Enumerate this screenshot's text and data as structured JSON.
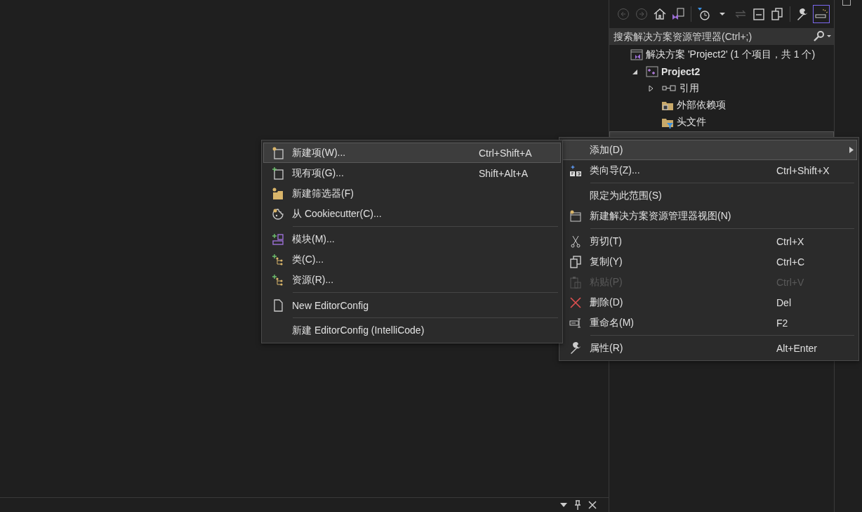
{
  "solution_explorer": {
    "toolbar": [
      {
        "kind": "back",
        "disabled": true
      },
      {
        "kind": "forward",
        "disabled": true
      },
      {
        "kind": "home",
        "disabled": false
      },
      {
        "kind": "views",
        "disabled": false
      },
      {
        "kind": "separator"
      },
      {
        "kind": "pending",
        "disabled": false
      },
      {
        "kind": "dropdown",
        "disabled": false
      },
      {
        "kind": "sync",
        "disabled": true
      },
      {
        "kind": "collapse",
        "disabled": false
      },
      {
        "kind": "copies",
        "disabled": false
      },
      {
        "kind": "separator"
      },
      {
        "kind": "properties",
        "disabled": false
      },
      {
        "kind": "preview",
        "disabled": false,
        "selected": true
      }
    ],
    "search": {
      "placeholder": "搜索解决方案资源管理器(Ctrl+;)"
    },
    "tree": [
      {
        "label": "解决方案 'Project2' (1 个项目，共 1 个)",
        "kind": "solution",
        "children": [
          {
            "label": "Project2",
            "kind": "project",
            "expanded": true,
            "children": [
              {
                "label": "引用",
                "kind": "references",
                "expanded": false
              },
              {
                "label": "外部依赖项",
                "kind": "external"
              },
              {
                "label": "头文件",
                "kind": "filter"
              }
            ]
          }
        ]
      }
    ]
  },
  "context_menu": [
    {
      "kind": "plain",
      "label": "添加(D)",
      "highlighted": true,
      "has_submenu": true,
      "disabled": false
    },
    {
      "kind": "wizard",
      "label": "类向导(Z)...",
      "shortcut": "Ctrl+Shift+X",
      "highlighted": false,
      "has_submenu": false,
      "disabled": false
    },
    {
      "kind": "separator"
    },
    {
      "kind": "plain",
      "label": "限定为此范围(S)",
      "highlighted": false,
      "has_submenu": false,
      "disabled": false
    },
    {
      "kind": "newview",
      "label": "新建解决方案资源管理器视图(N)",
      "highlighted": false,
      "has_submenu": false,
      "disabled": false
    },
    {
      "kind": "separator"
    },
    {
      "kind": "scissors",
      "label": "剪切(T)",
      "shortcut": "Ctrl+X",
      "highlighted": false,
      "has_submenu": false,
      "disabled": false
    },
    {
      "kind": "copy",
      "label": "复制(Y)",
      "shortcut": "Ctrl+C",
      "highlighted": false,
      "has_submenu": false,
      "disabled": false
    },
    {
      "kind": "paste",
      "label": "粘贴(P)",
      "shortcut": "Ctrl+V",
      "highlighted": false,
      "has_submenu": false,
      "disabled": true
    },
    {
      "kind": "delete",
      "label": "删除(D)",
      "shortcut": "Del",
      "highlighted": false,
      "has_submenu": false,
      "disabled": false
    },
    {
      "kind": "rename",
      "label": "重命名(M)",
      "shortcut": "F2",
      "highlighted": false,
      "has_submenu": false,
      "disabled": false
    },
    {
      "kind": "separator"
    },
    {
      "kind": "wrench",
      "label": "属性(R)",
      "shortcut": "Alt+Enter",
      "highlighted": false,
      "has_submenu": false,
      "disabled": false
    }
  ],
  "submenu": [
    {
      "kind": "newitem",
      "label": "新建项(W)...",
      "shortcut": "Ctrl+Shift+A",
      "highlighted": true,
      "has_submenu": false,
      "disabled": false
    },
    {
      "kind": "existing",
      "label": "现有项(G)...",
      "shortcut": "Shift+Alt+A",
      "highlighted": false,
      "has_submenu": false,
      "disabled": false
    },
    {
      "kind": "folder",
      "label": "新建筛选器(F)",
      "highlighted": false,
      "has_submenu": false,
      "disabled": false
    },
    {
      "kind": "cookie",
      "label": "从 Cookiecutter(C)...",
      "highlighted": false,
      "has_submenu": false,
      "disabled": false
    },
    {
      "kind": "separator"
    },
    {
      "kind": "module",
      "label": "模块(M)...",
      "highlighted": false,
      "has_submenu": false,
      "disabled": false
    },
    {
      "kind": "class",
      "label": "类(C)...",
      "highlighted": false,
      "has_submenu": false,
      "disabled": false
    },
    {
      "kind": "class",
      "label": "资源(R)...",
      "highlighted": false,
      "has_submenu": false,
      "disabled": false
    },
    {
      "kind": "separator"
    },
    {
      "kind": "file",
      "label": "New EditorConfig",
      "highlighted": false,
      "has_submenu": false,
      "disabled": false
    },
    {
      "kind": "separator"
    },
    {
      "kind": "plain",
      "label": "新建 EditorConfig (IntelliCode)",
      "highlighted": false,
      "has_submenu": false,
      "disabled": false
    }
  ]
}
